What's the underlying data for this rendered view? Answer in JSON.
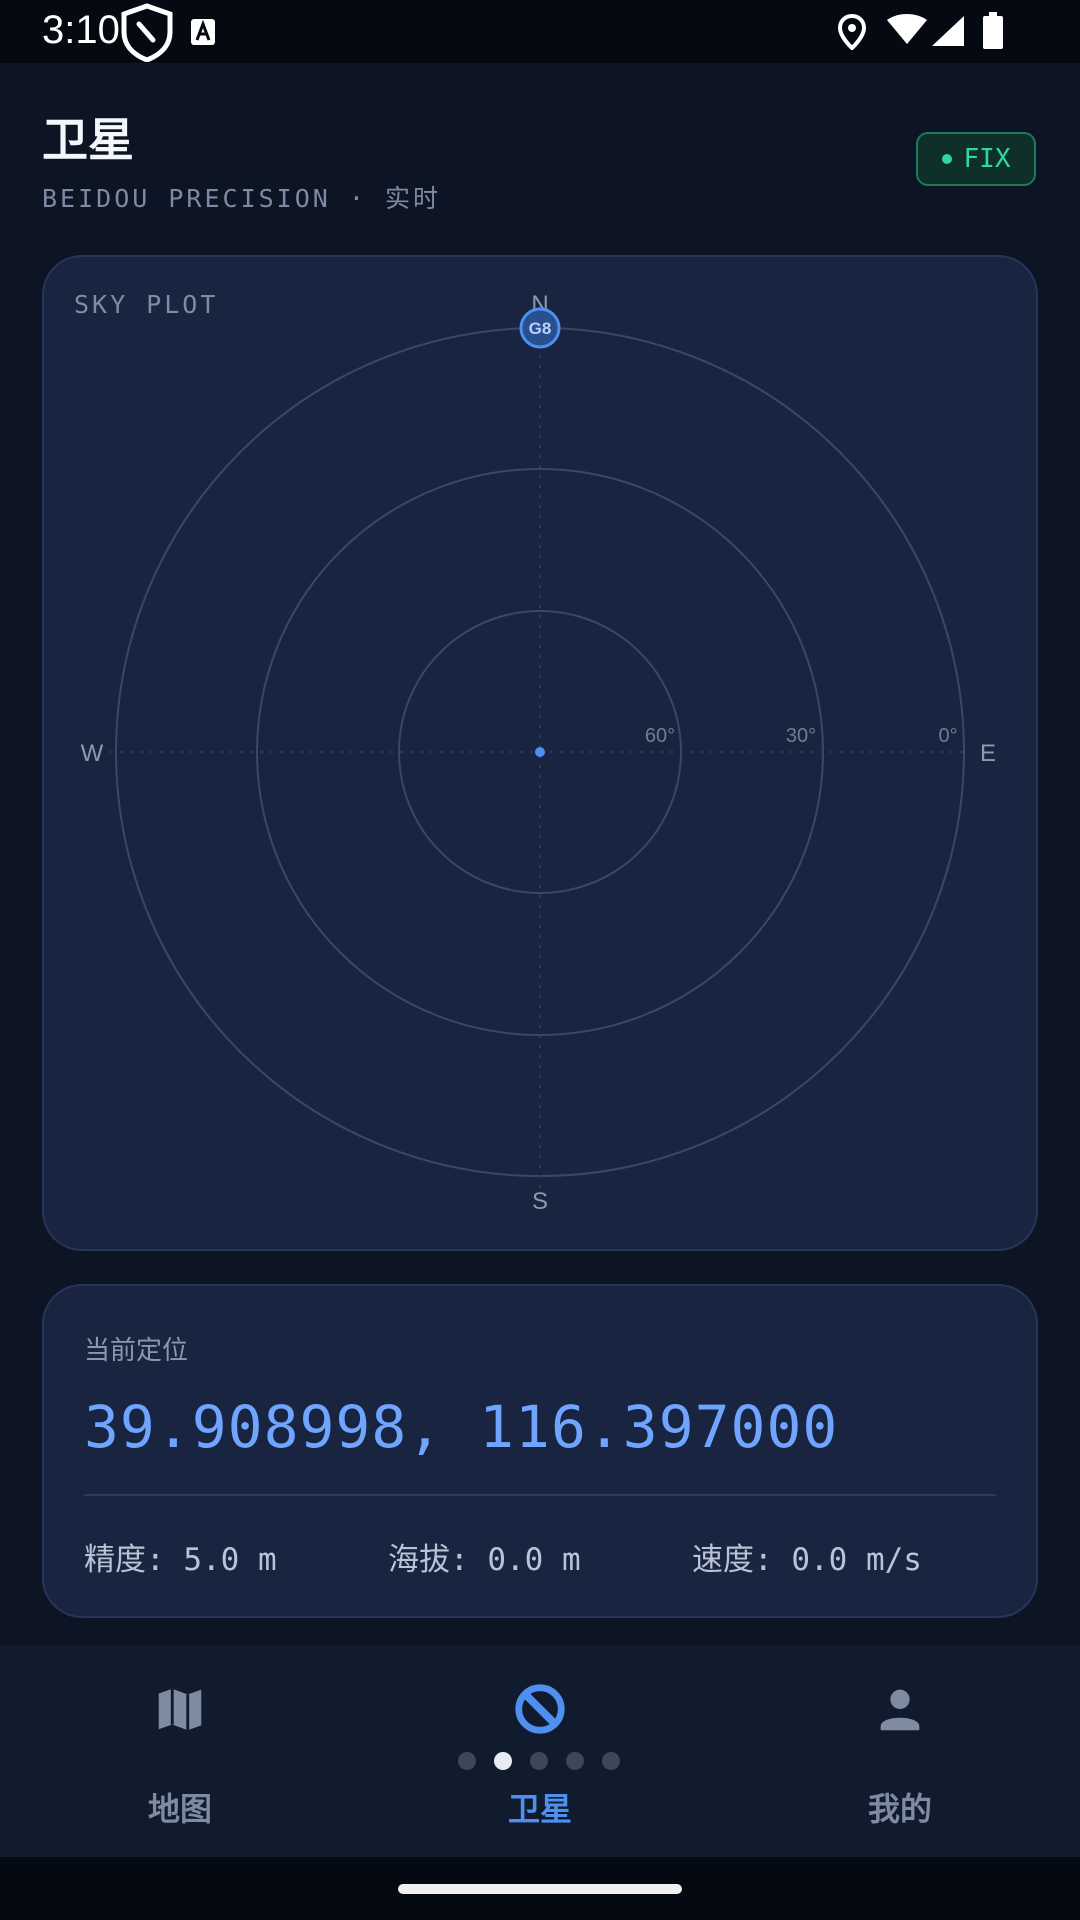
{
  "status_bar": {
    "time": "3:10",
    "icons": [
      "shield-icon",
      "text-a-icon",
      "location-icon",
      "wifi-icon",
      "signal-icon",
      "battery-icon"
    ]
  },
  "header": {
    "title": "卫星",
    "subtitle": "BEIDOU PRECISION · 实时",
    "badge": "FIX",
    "badge_color": "#2fd99a"
  },
  "sky_plot": {
    "label": "SKY PLOT",
    "compass": {
      "north": "N",
      "south": "S",
      "east": "E",
      "west": "W"
    },
    "elevation_labels": [
      "60°",
      "30°",
      "0°"
    ],
    "satellites": [
      {
        "label": "G8",
        "azimuth": 0,
        "elevation": 0
      }
    ],
    "accent_color": "#4f8ff0"
  },
  "position": {
    "label": "当前定位",
    "coords": "39.908998, 116.397000",
    "accuracy": "精度: 5.0 m",
    "altitude": "海拔: 0.0 m",
    "speed": "速度: 0.0 m/s"
  },
  "bottom_nav": {
    "items": [
      {
        "label": "地图",
        "icon": "map-icon"
      },
      {
        "label": "卫星",
        "icon": "satellite-icon"
      },
      {
        "label": "我的",
        "icon": "person-icon"
      }
    ],
    "active_index": 1,
    "pager_dots": 5,
    "pager_active": 1
  }
}
